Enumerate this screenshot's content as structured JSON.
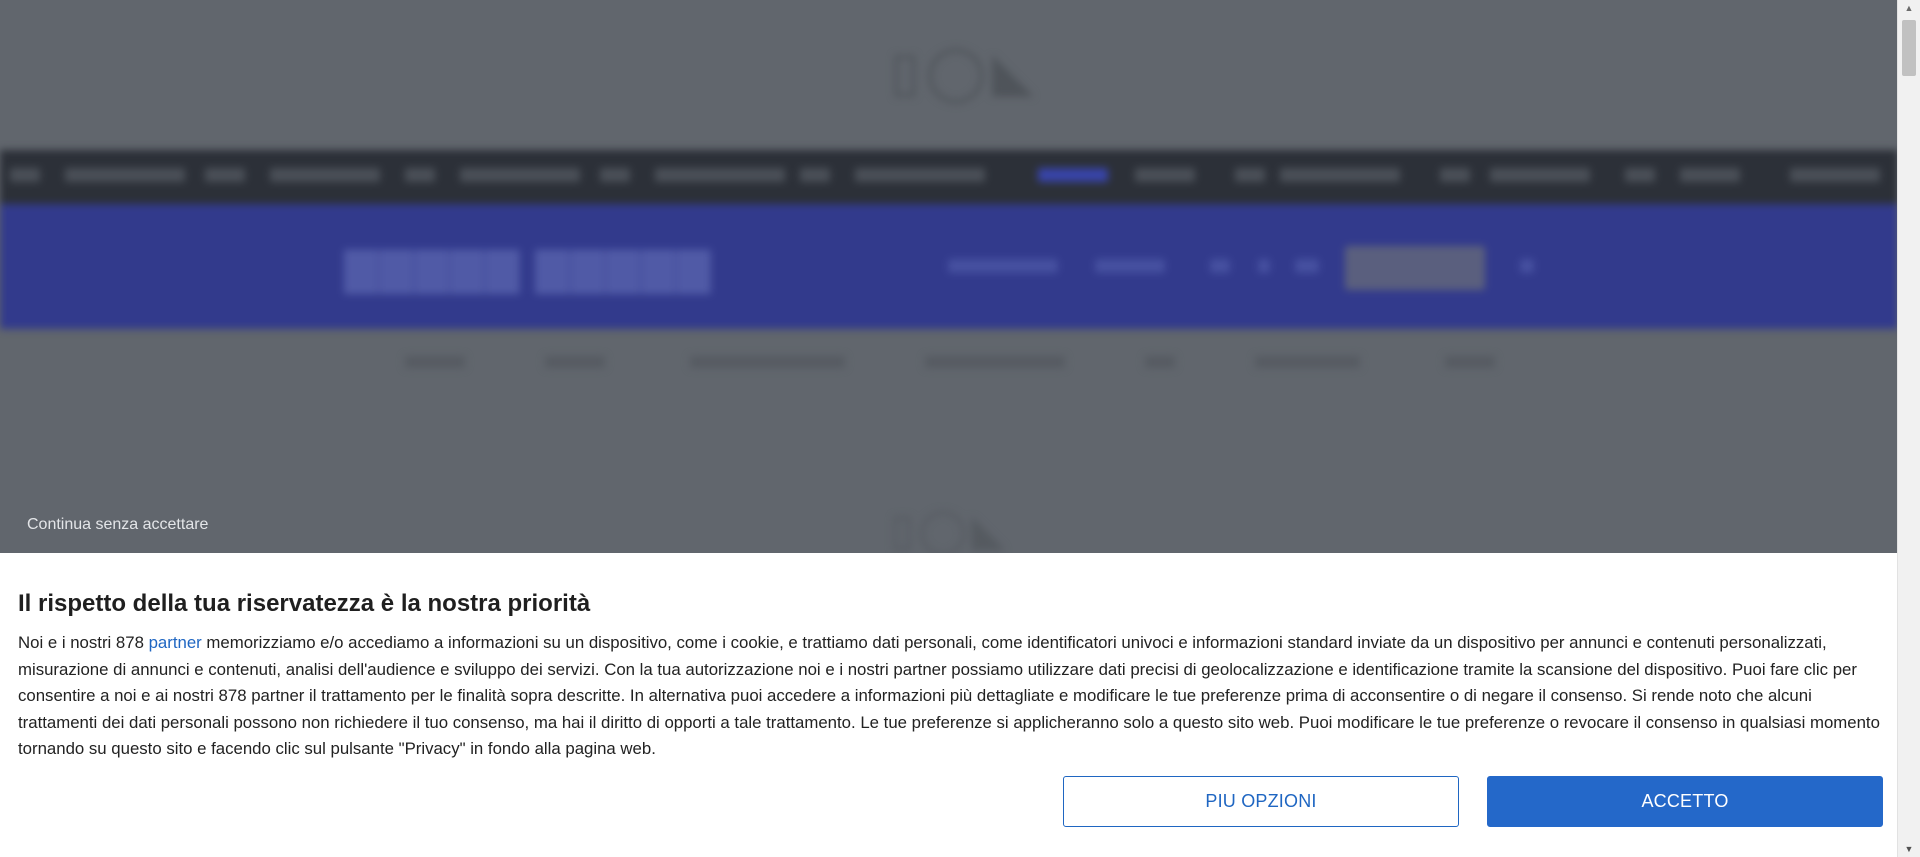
{
  "background_page": {
    "skip_link_label": "Continua senza accettare"
  },
  "consent": {
    "title": "Il rispetto della tua riservatezza è la nostra priorità",
    "body_prefix": "Noi e i nostri 878 ",
    "partner_link": "partner",
    "body_suffix": " memorizziamo e/o accediamo a informazioni su un dispositivo, come i cookie, e trattiamo dati personali, come identificatori univoci e informazioni standard inviate da un dispositivo per annunci e contenuti personalizzati, misurazione di annunci e contenuti, analisi dell'audience e sviluppo dei servizi. Con la tua autorizzazione noi e i nostri partner possiamo utilizzare dati precisi di geolocalizzazione e identificazione tramite la scansione del dispositivo. Puoi fare clic per consentire a noi e ai nostri 878 partner il trattamento per le finalità sopra descritte. In alternativa puoi accedere a informazioni più dettagliate e modificare le tue preferenze prima di acconsentire o di negare il consenso. Si rende noto che alcuni trattamenti dei dati personali possono non richiedere il tuo consenso, ma hai il diritto di opporti a tale trattamento. Le tue preferenze si applicheranno solo a questo sito web. Puoi modificare le tue preferenze o revocare il consenso in qualsiasi momento tornando su questo sito e facendo clic sul pulsante \"Privacy\" in fondo alla pagina web.",
    "more_options_label": "PIU OPZIONI",
    "accept_label": "ACCETTO"
  },
  "colors": {
    "accent": "#2468c9",
    "link": "#1f66c2",
    "overlay": "#5f646b"
  }
}
